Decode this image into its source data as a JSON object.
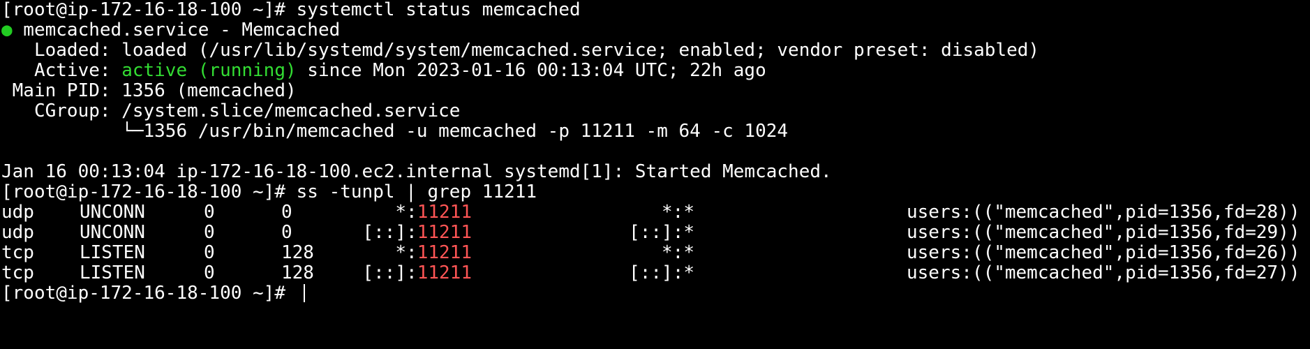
{
  "prompt": "[root@ip-172-16-18-100 ~]# ",
  "cmd1": "systemctl status memcached",
  "status": {
    "dot": "●",
    "header": " memcached.service - Memcached",
    "loaded": "   Loaded: loaded (/usr/lib/systemd/system/memcached.service; enabled; vendor preset: disabled)",
    "active_label": "   Active: ",
    "active_state": "active (running)",
    "active_since": " since Mon 2023-01-16 00:13:04 UTC; 22h ago",
    "main_pid": " Main PID: 1356 (memcached)",
    "cgroup": "   CGroup: /system.slice/memcached.service",
    "cgroup_tree": "           └─1356 /usr/bin/memcached -u memcached -p 11211 -m 64 -c 1024",
    "log": "Jan 16 00:13:04 ip-172-16-18-100.ec2.internal systemd[1]: Started Memcached."
  },
  "cmd2": "ss -tunpl | grep 11211",
  "sockets": [
    {
      "proto": "udp",
      "state": "UNCONN",
      "recvq": "0",
      "sendq": "0",
      "local_addr": "*:",
      "local_port": "11211",
      "peer": "*:*",
      "process": "users:((\"memcached\",pid=1356,fd=28))"
    },
    {
      "proto": "udp",
      "state": "UNCONN",
      "recvq": "0",
      "sendq": "0",
      "local_addr": "[::]:",
      "local_port": "11211",
      "peer": "[::]:*",
      "process": "users:((\"memcached\",pid=1356,fd=29))"
    },
    {
      "proto": "tcp",
      "state": "LISTEN",
      "recvq": "0",
      "sendq": "128",
      "local_addr": "*:",
      "local_port": "11211",
      "peer": "*:*",
      "process": "users:((\"memcached\",pid=1356,fd=26))"
    },
    {
      "proto": "tcp",
      "state": "LISTEN",
      "recvq": "0",
      "sendq": "128",
      "local_addr": "[::]:",
      "local_port": "11211",
      "peer": "[::]:*",
      "process": "users:((\"memcached\",pid=1356,fd=27))"
    }
  ],
  "colors": {
    "background": "#000000",
    "foreground": "#ffffff",
    "active_green": "#33dd33",
    "port_red": "#ff5555"
  }
}
